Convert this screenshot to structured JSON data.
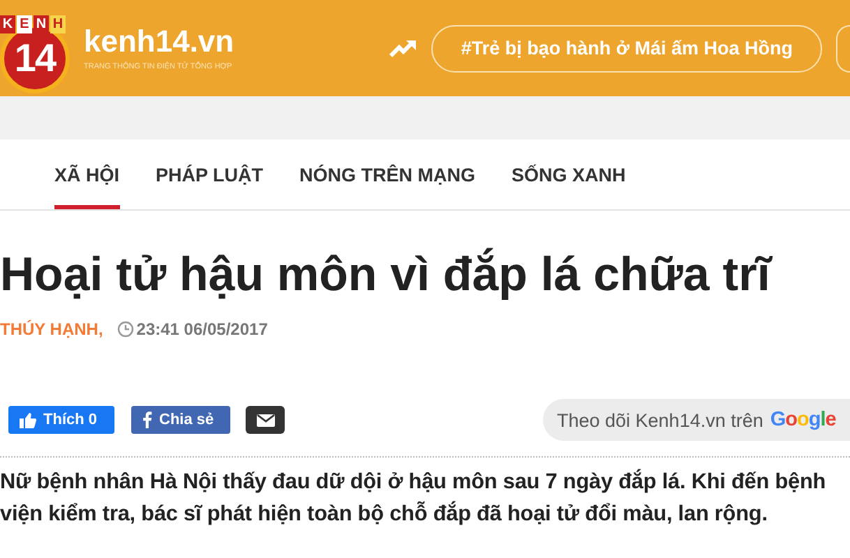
{
  "header": {
    "logo_top": [
      "K",
      "E",
      "N",
      "H"
    ],
    "logo_number": "14",
    "site_name": "kenh14.vn",
    "tagline": "TRANG THÔNG TIN ĐIỆN TỬ TỔNG HỢP",
    "trending": "#Trẻ bị bạo hành ở Mái ấm Hoa Hồng"
  },
  "nav": [
    {
      "label": "XÃ HỘI",
      "selected": true
    },
    {
      "label": "PHÁP LUẬT",
      "selected": false
    },
    {
      "label": "NÓNG TRÊN MẠNG",
      "selected": false
    },
    {
      "label": "SỐNG XANH",
      "selected": false
    }
  ],
  "article": {
    "title": "Hoại tử hậu môn vì đắp lá chữa trĩ",
    "author": "THÚY HẠNH,",
    "time": "23:41 06/05/2017",
    "like": "Thích 0",
    "share": "Chia sẻ",
    "follow": "Theo dõi Kenh14.vn trên",
    "follow_brand": [
      "G",
      "o",
      "o",
      "g",
      "l",
      "e"
    ],
    "lead": [
      "Nữ bệnh nhân Hà Nội thấy đau dữ dội ở hậu môn sau 7 ngày đắp lá. Khi đến bệnh",
      "viện kiểm tra, bác sĩ phát hiện toàn bộ chỗ đắp đã hoại tử đổi màu, lan rộng."
    ]
  }
}
